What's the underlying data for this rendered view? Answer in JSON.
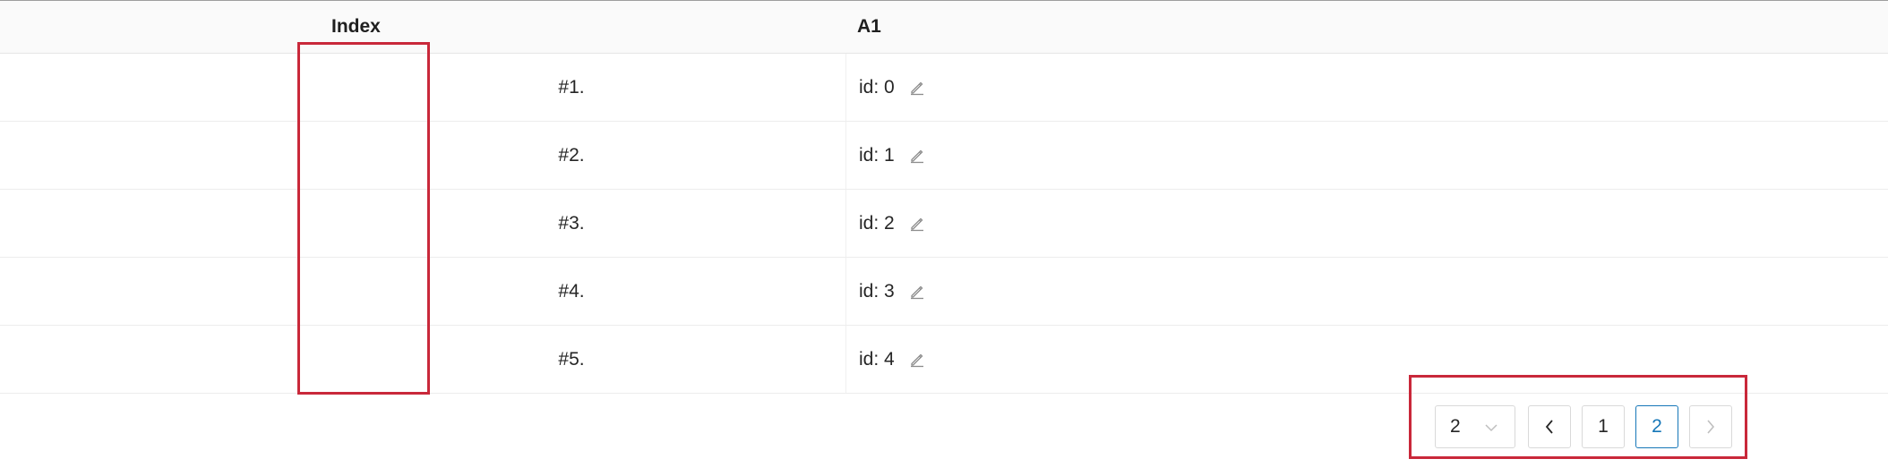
{
  "table": {
    "headers": {
      "index": "Index",
      "a1": "A1"
    },
    "rows": [
      {
        "index": "#1.",
        "a1": "id: 0"
      },
      {
        "index": "#2.",
        "a1": "id: 1"
      },
      {
        "index": "#3.",
        "a1": "id: 2"
      },
      {
        "index": "#4.",
        "a1": "id: 3"
      },
      {
        "index": "#5.",
        "a1": "id: 4"
      }
    ]
  },
  "pagination": {
    "page_size": "2",
    "pages": [
      "1",
      "2"
    ],
    "current_page": "2"
  },
  "colors": {
    "active": "#1677b8",
    "highlight_box": "#c9283a"
  }
}
